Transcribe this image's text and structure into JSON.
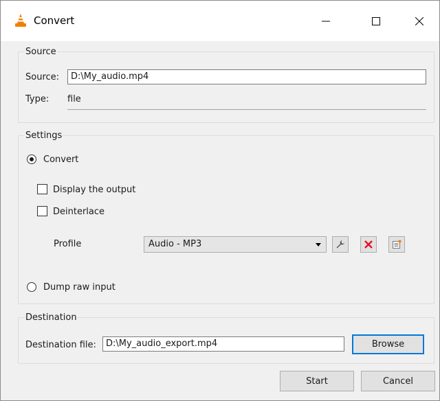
{
  "window": {
    "title": "Convert",
    "icon": "vlc-cone-icon",
    "controls": {
      "minimize": "minimize-icon",
      "maximize": "maximize-icon",
      "close": "close-icon"
    }
  },
  "source_group": {
    "title": "Source",
    "source_label": "Source:",
    "source_value": "D:\\My_audio.mp4",
    "type_label": "Type:",
    "type_value": "file"
  },
  "settings_group": {
    "title": "Settings",
    "convert_label": "Convert",
    "convert_selected": true,
    "display_output_label": "Display the output",
    "display_output_checked": false,
    "deinterlace_label": "Deinterlace",
    "deinterlace_checked": false,
    "profile_label": "Profile",
    "profile_value": "Audio - MP3",
    "profile_buttons": [
      "wrench-icon",
      "delete-x-icon",
      "new-profile-icon"
    ],
    "dump_raw_label": "Dump raw input",
    "dump_raw_selected": false
  },
  "destination_group": {
    "title": "Destination",
    "dest_label": "Destination file:",
    "dest_value": "D:\\My_audio_export.mp4",
    "browse_label": "Browse"
  },
  "footer": {
    "start_label": "Start",
    "cancel_label": "Cancel"
  },
  "colors": {
    "accent": "#0078d7",
    "delete": "#e81123",
    "vlc_orange": "#f08000"
  }
}
